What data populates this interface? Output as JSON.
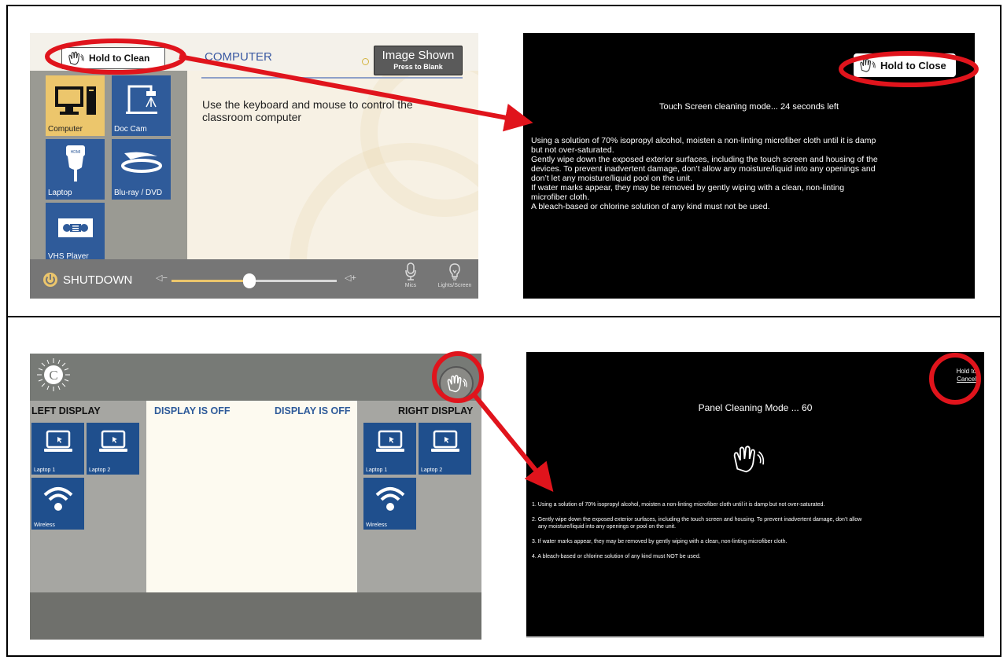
{
  "panel1": {
    "hold_to_clean": "Hold to Clean",
    "section_title": "COMPUTER",
    "image_shown": "Image Shown",
    "press_to_blank": "Press to Blank",
    "description": "Use the keyboard and mouse to control the classroom computer",
    "sources": [
      {
        "label": "Computer",
        "icon": "computer-icon",
        "selected": true
      },
      {
        "label": "Doc Cam",
        "icon": "doc-cam-icon",
        "selected": false
      },
      {
        "label": "Laptop",
        "icon": "hdmi-icon",
        "selected": false
      },
      {
        "label": "Blu-ray / DVD",
        "icon": "bluray-icon",
        "selected": false
      },
      {
        "label": "VHS Player",
        "icon": "vhs-icon",
        "selected": false
      }
    ],
    "shutdown": "SHUTDOWN",
    "volume_level": 0.47,
    "mics": "Mics",
    "lights_screen": "Lights/Screen"
  },
  "panel2": {
    "hold_to_close": "Hold to Close",
    "countdown": "Touch Screen cleaning mode... 24 seconds left",
    "instructions": [
      " Using a solution of 70% isopropyl alcohol, moisten a non-linting microfiber cloth until it is damp",
      " but not over-saturated.",
      "Gently wipe down the exposed exterior surfaces, including the touch screen and housing of the",
      "devices.  To prevent inadvertent damage, don’t allow any moisture/liquid into any openings and",
      "don’t let any moisture/liquid pool on the unit.",
      "If water marks appear, they may be removed by gently wiping with a clean, non-linting",
      "microfiber cloth.",
      "A bleach-based or chlorine solution of any kind must not be used."
    ]
  },
  "panel3": {
    "logo_letter": "C",
    "left_display": "LEFT DISPLAY",
    "right_display": "RIGHT DISPLAY",
    "display_off_left": "DISPLAY IS OFF",
    "display_off_right": "DISPLAY IS OFF",
    "left_tiles": [
      "Laptop 1",
      "Laptop 2",
      "Wireless"
    ],
    "right_tiles": [
      "Laptop 1",
      "Laptop 2",
      "Wireless"
    ]
  },
  "panel4": {
    "hold_to": "Hold to",
    "cancel": "Cancel",
    "heading": "Panel Cleaning Mode ... 60",
    "step1": "1. Using a solution of 70% isopropyl alcohol, moisten a non-linting microfiber cloth until it is damp but not over-saturated.",
    "step2a": "2. Gently wipe down the exposed exterior surfaces, including the touch screen and housing.  To prevent inadvertent damage, don’t allow",
    "step2b": "any moisture/liquid into any openings or pool on the unit.",
    "step3": "3.  If water marks appear, they may be removed by gently wiping with a clean, non-linting microfiber cloth.",
    "step4": "4. A bleach-based or chlorine solution of any kind must NOT be used."
  },
  "colors": {
    "annotation_red": "#e0141c",
    "crestron_blue": "#1f4f8d",
    "amx_blue": "#2f5b9a",
    "amx_gold": "#ecc66c"
  }
}
